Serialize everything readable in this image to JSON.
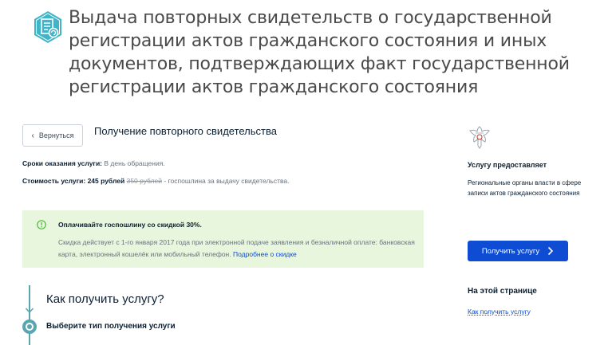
{
  "header": {
    "title": "Выдача повторных свидетельств о государственной регистрации актов гражданского состояния и иных документов, подтверждающих факт государственной регистрации актов гражданского состояния",
    "icon": "document-certificate-icon",
    "icon_color": "#40b5c7"
  },
  "back_button": {
    "label": "Вернуться",
    "icon": "chevron-left-icon"
  },
  "section": {
    "title": "Получение повторного свидетельства"
  },
  "terms": {
    "label": "Сроки оказания услуги:",
    "value": "В день обращения."
  },
  "cost": {
    "label": "Стоимость услуги:",
    "price": "245 рублей",
    "old_price": "350 рублей",
    "note": "- госпошлина за выдачу свидетельства."
  },
  "discount": {
    "icon": "info-circle-icon",
    "title": "Оплачивайте госпошлину со скидкой 30%.",
    "text": "Скидка действует с 1-го января 2017 года при электронной подаче заявления и безналичной оплате: банковская карта, электронный кошелёк или мобильный телефон.",
    "link": "Подробнее о скидке",
    "background": "#e8f6dd",
    "icon_color": "#4eb93c"
  },
  "steps": {
    "title": "Как получить услугу?",
    "first_step": "Выберите тип получения услуги",
    "line_color": "#5aa6b0"
  },
  "sidebar": {
    "emblem": "coat-of-arms-icon",
    "provider_title": "Услугу предоставляет",
    "provider_name": "Региональные органы власти в сфере записи актов гражданского состояния",
    "cta_label": "Получить услугу",
    "cta_icon": "chevron-right-icon",
    "cta_color": "#0d4cd3",
    "on_page_title": "На этой странице",
    "toc": [
      "Как получить услугу"
    ]
  }
}
